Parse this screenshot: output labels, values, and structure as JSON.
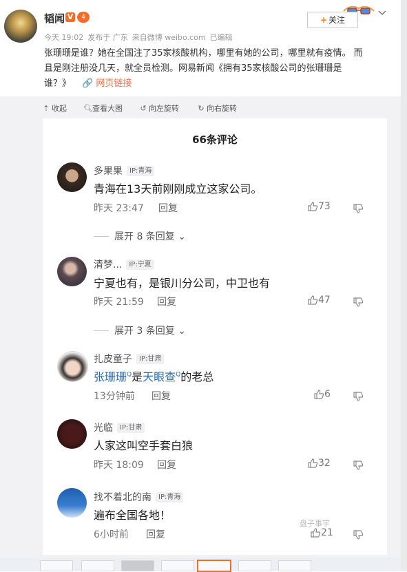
{
  "post": {
    "author": "韬闻",
    "verified_badge": "V",
    "level_badge": "4",
    "meta": {
      "time": "今天 19:02",
      "publish": "发布于 广东",
      "source": "来自微博 weibo.com",
      "edited": "已编辑"
    },
    "follow_label": "关注",
    "text_line1": "张珊珊是谁？她在全国注了35家核酸机构，哪里有她的公司，哪里就有疫情。 而",
    "text_line2": "且是刚注册没几天，就全员检测。网易新闻《拥有35家核酸公司的张珊珊是",
    "text_line3_prefix": "谁？》",
    "link_label": "网页链接"
  },
  "toolbar": {
    "collapse": "收起",
    "view_large": "查看大图",
    "rotate_left": "向左旋转",
    "rotate_right": "向右旋转"
  },
  "comments_panel": {
    "title": "66条评论",
    "comments": [
      {
        "name": "多果果",
        "ip": "IP:青海",
        "text": "青海在13天前刚刚成立这家公司。",
        "time": "昨天 23:47",
        "reply": "回复",
        "likes": "73",
        "expand": "展开 8 条回复"
      },
      {
        "name": "清梦...",
        "ip": "IP:宁夏",
        "text": "宁夏也有，是银川分公司，中卫也有",
        "time": "昨天 21:59",
        "reply": "回复",
        "likes": "47",
        "expand": "展开 3 条回复"
      },
      {
        "name": "扎皮童子",
        "ip": "IP:甘肃",
        "text_link1": "张珊珊",
        "text_link2": "天眼查",
        "text_join": "是",
        "text_tail": "的老总",
        "time": "13分钟前",
        "reply": "回复",
        "likes": "6"
      },
      {
        "name": "光临",
        "ip": "IP:甘肃",
        "text": "人家这叫空手套白狼",
        "time": "昨天 18:09",
        "reply": "回复",
        "likes": "32"
      },
      {
        "name": "找不着北的南",
        "ip": "IP:青海",
        "text": "遍布全国各地！",
        "time": "6小时前",
        "reply": "回复",
        "likes": "21"
      }
    ]
  },
  "watermark": "盘子事宇",
  "colors": {
    "accent": "#eb7350",
    "link": "#2f6ba8",
    "verified": "#f36d21",
    "follow_plus": "#ff8200"
  }
}
